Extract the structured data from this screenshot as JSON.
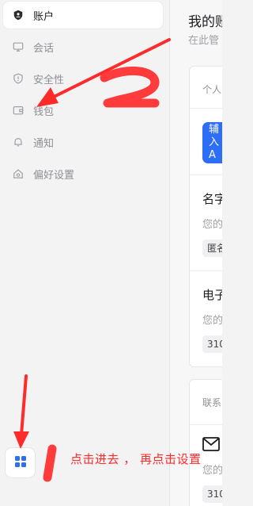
{
  "sidebar": {
    "items": [
      {
        "label": "账户",
        "icon": "account-shield-icon",
        "active": true
      },
      {
        "label": "会话",
        "icon": "monitor-icon",
        "active": false
      },
      {
        "label": "安全性",
        "icon": "shield-icon",
        "active": false
      },
      {
        "label": "钱包",
        "icon": "wallet-icon",
        "active": false
      },
      {
        "label": "通知",
        "icon": "bell-icon",
        "active": false
      },
      {
        "label": "偏好设置",
        "icon": "home-gear-icon",
        "active": false
      }
    ],
    "apps_button_icon": "apps-grid-icon"
  },
  "main": {
    "title": "我的账",
    "subtitle": "在此管",
    "personal_section": {
      "header": "个人",
      "avatar_text_line1": "辅",
      "avatar_text_line2": "入",
      "avatar_text_line3": "A",
      "name_label": "名字",
      "name_hint": "您的",
      "name_value": "匿名",
      "email_label": "电子",
      "email_hint": "您的",
      "email_value": "310"
    },
    "contact_section": {
      "header": "联系",
      "contact_hint": "您的",
      "contact_value": "310",
      "mail_icon": "envelope-icon"
    }
  },
  "annotations": {
    "number_mark": "2",
    "instruction": "点击进去 ， 再点击设置",
    "color": "#ff2a2a"
  },
  "colors": {
    "sidebar_bg": "#f3f3f4",
    "active_item_bg": "#ffffff",
    "accent_blue": "#2d6ef6",
    "annotation_red": "#ff2a2a"
  }
}
